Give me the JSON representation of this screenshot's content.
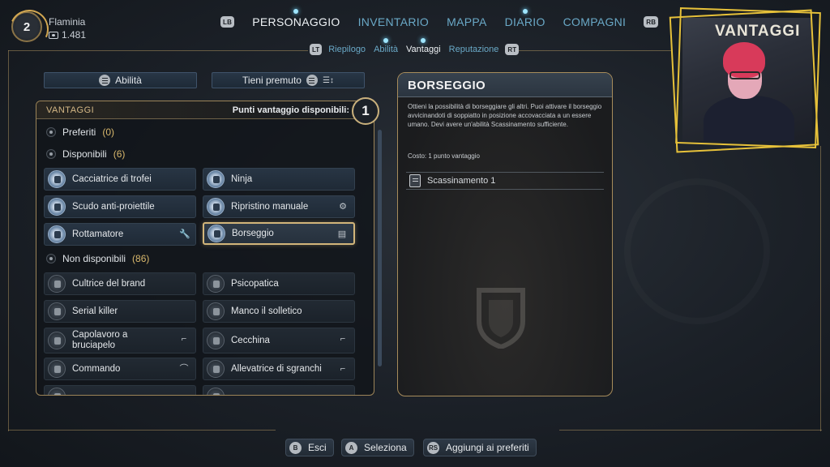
{
  "player": {
    "level": "2",
    "name": "Flaminia",
    "gold": "1.481"
  },
  "nav": {
    "lb": "LB",
    "rb": "RB",
    "tabs": [
      "PERSONAGGIO",
      "INVENTARIO",
      "MAPPA",
      "DIARIO",
      "COMPAGNI"
    ],
    "active": "PERSONAGGIO"
  },
  "subnav": {
    "lt": "LT",
    "rt": "RT",
    "tabs": [
      "Riepilogo",
      "Abilità",
      "Vantaggi",
      "Reputazione"
    ],
    "active": "Vantaggi"
  },
  "toolbar": {
    "skills_label": "Abilità",
    "hold_label": "Tieni premuto"
  },
  "perks_panel": {
    "title": "VANTAGGI",
    "points_label": "Punti vantaggio disponibili:",
    "points": "1",
    "favorites": {
      "label": "Preferiti",
      "count": "(0)"
    },
    "available": {
      "label": "Disponibili",
      "count": "(6)"
    },
    "unavailable": {
      "label": "Non disponibili",
      "count": "(86)"
    },
    "available_items": [
      {
        "label": "Cacciatrice di trofei",
        "icon": "trophy-icon",
        "tool": ""
      },
      {
        "label": "Ninja",
        "icon": "ninja-icon",
        "tool": ""
      },
      {
        "label": "Scudo anti-proiettile",
        "icon": "shield-icon",
        "tool": ""
      },
      {
        "label": "Ripristino manuale",
        "icon": "gear-icon",
        "tool": "⚙"
      },
      {
        "label": "Rottamatore",
        "icon": "scrap-icon",
        "tool": "🔧"
      },
      {
        "label": "Borseggio",
        "icon": "hand-icon",
        "tool": "▤"
      }
    ],
    "unavailable_items": [
      {
        "label": "Cultrice del brand",
        "icon": "badge-icon",
        "tool": ""
      },
      {
        "label": "Psicopatica",
        "icon": "mask-icon",
        "tool": ""
      },
      {
        "label": "Serial killer",
        "icon": "knife-icon",
        "tool": ""
      },
      {
        "label": "Manco il solletico",
        "icon": "feather-icon",
        "tool": ""
      },
      {
        "label": "Capolavoro a bruciapelo",
        "icon": "gun-icon",
        "tool": "⌐"
      },
      {
        "label": "Cecchina",
        "icon": "scope-icon",
        "tool": "⌐"
      },
      {
        "label": "Commando",
        "icon": "commando-icon",
        "tool": "⌒"
      },
      {
        "label": "Allevatrice di sgranchi",
        "icon": "creature-icon",
        "tool": "⌐"
      }
    ],
    "selected": "Borseggio"
  },
  "detail": {
    "title": "BORSEGGIO",
    "description": "Ottieni la possibilità di borseggiare gli altri. Puoi attivare il borseggio avvicinandoti di soppiatto in posizione accovacciata a un essere umano. Devi avere un'abilità Scassinamento sufficiente.",
    "cost": "Costo: 1 punto vantaggio",
    "requirement": "Scassinamento 1"
  },
  "webcam": {
    "title": "VANTAGGI",
    "frame_color": "#e6c13a"
  },
  "footer": [
    {
      "key": "B",
      "label": "Esci"
    },
    {
      "key": "A",
      "label": "Seleziona"
    },
    {
      "key": "RS",
      "label": "Aggiungi ai preferiti"
    }
  ],
  "colors": {
    "accent_gold": "#d2b57a",
    "inactive_tab": "#6aa9c7",
    "active_tab": "#eef2f5"
  }
}
